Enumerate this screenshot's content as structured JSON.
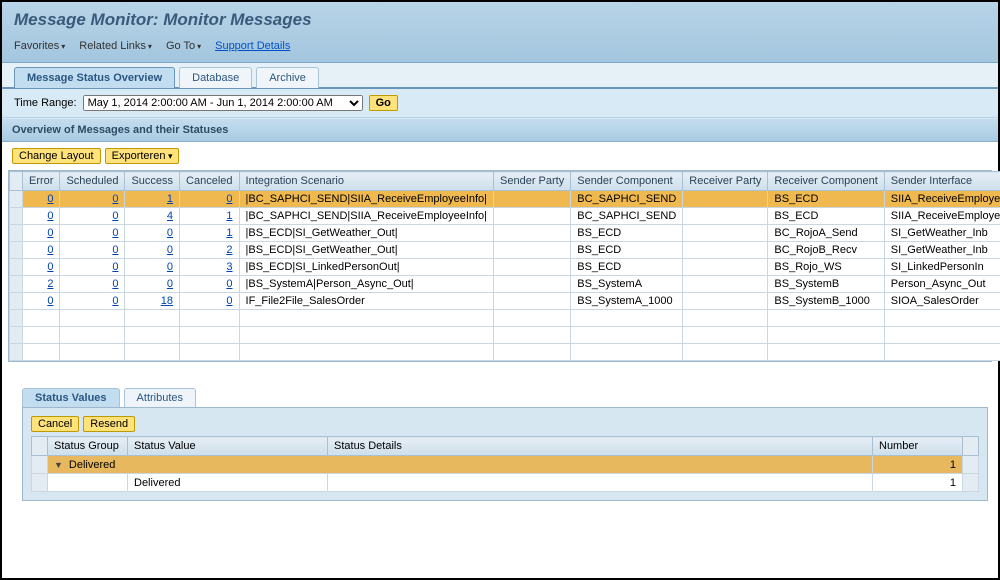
{
  "page_title": "Message Monitor: Monitor Messages",
  "top_nav": {
    "favorites": "Favorites",
    "related_links": "Related Links",
    "go_to": "Go To",
    "support_details": "Support Details"
  },
  "main_tabs": {
    "overview": "Message Status Overview",
    "database": "Database",
    "archive": "Archive"
  },
  "filter": {
    "label": "Time Range:",
    "value": "May 1, 2014 2:00:00 AM - Jun 1, 2014 2:00:00 AM",
    "go": "Go"
  },
  "overview_section_title": "Overview of Messages and their Statuses",
  "toolbar": {
    "change_layout": "Change Layout",
    "exporteren": "Exporteren"
  },
  "grid": {
    "columns": {
      "error": "Error",
      "scheduled": "Scheduled",
      "success": "Success",
      "canceled": "Canceled",
      "integration_scenario": "Integration Scenario",
      "sender_party": "Sender Party",
      "sender_component": "Sender Component",
      "receiver_party": "Receiver Party",
      "receiver_component": "Receiver Component",
      "sender_interface": "Sender Interface"
    },
    "rows": [
      {
        "selected": true,
        "error": "0",
        "scheduled": "0",
        "success": "1",
        "canceled": "0",
        "scenario": "|BC_SAPHCI_SEND|SIIA_ReceiveEmployeeInfo|",
        "sender_party": "",
        "sender_component": "BC_SAPHCI_SEND",
        "receiver_party": "",
        "receiver_component": "BS_ECD",
        "sender_interface": "SIIA_ReceiveEmployeeInfo"
      },
      {
        "selected": false,
        "error": "0",
        "scheduled": "0",
        "success": "4",
        "canceled": "1",
        "scenario": "|BC_SAPHCI_SEND|SIIA_ReceiveEmployeeInfo|",
        "sender_party": "",
        "sender_component": "BC_SAPHCI_SEND",
        "receiver_party": "",
        "receiver_component": "BS_ECD",
        "sender_interface": "SIIA_ReceiveEmployeeInfo_ECC"
      },
      {
        "selected": false,
        "error": "0",
        "scheduled": "0",
        "success": "0",
        "canceled": "1",
        "scenario": "|BS_ECD|SI_GetWeather_Out|",
        "sender_party": "",
        "sender_component": "BS_ECD",
        "receiver_party": "",
        "receiver_component": "BC_RojoA_Send",
        "sender_interface": "SI_GetWeather_Inb"
      },
      {
        "selected": false,
        "error": "0",
        "scheduled": "0",
        "success": "0",
        "canceled": "2",
        "scenario": "|BS_ECD|SI_GetWeather_Out|",
        "sender_party": "",
        "sender_component": "BS_ECD",
        "receiver_party": "",
        "receiver_component": "BC_RojoB_Recv",
        "sender_interface": "SI_GetWeather_Inb"
      },
      {
        "selected": false,
        "error": "0",
        "scheduled": "0",
        "success": "0",
        "canceled": "3",
        "scenario": "|BS_ECD|SI_LinkedPersonOut|",
        "sender_party": "",
        "sender_component": "BS_ECD",
        "receiver_party": "",
        "receiver_component": "BS_Rojo_WS",
        "sender_interface": "SI_LinkedPersonIn"
      },
      {
        "selected": false,
        "error": "2",
        "scheduled": "0",
        "success": "0",
        "canceled": "0",
        "scenario": "|BS_SystemA|Person_Async_Out|",
        "sender_party": "",
        "sender_component": "BS_SystemA",
        "receiver_party": "",
        "receiver_component": "BS_SystemB",
        "sender_interface": "Person_Async_Out"
      },
      {
        "selected": false,
        "error": "0",
        "scheduled": "0",
        "success": "18",
        "canceled": "0",
        "scenario": "IF_File2File_SalesOrder",
        "sender_party": "",
        "sender_component": "BS_SystemA_1000",
        "receiver_party": "",
        "receiver_component": "BS_SystemB_1000",
        "sender_interface": "SIOA_SalesOrder"
      }
    ]
  },
  "lower_tabs": {
    "status_values": "Status Values",
    "attributes": "Attributes"
  },
  "lower_toolbar": {
    "cancel": "Cancel",
    "resend": "Resend"
  },
  "status_grid": {
    "columns": {
      "status_group": "Status Group",
      "status_value": "Status Value",
      "status_details": "Status Details",
      "number": "Number"
    },
    "group_row": {
      "group": "Delivered",
      "number": "1"
    },
    "detail_row": {
      "value": "Delivered",
      "number": "1"
    }
  }
}
